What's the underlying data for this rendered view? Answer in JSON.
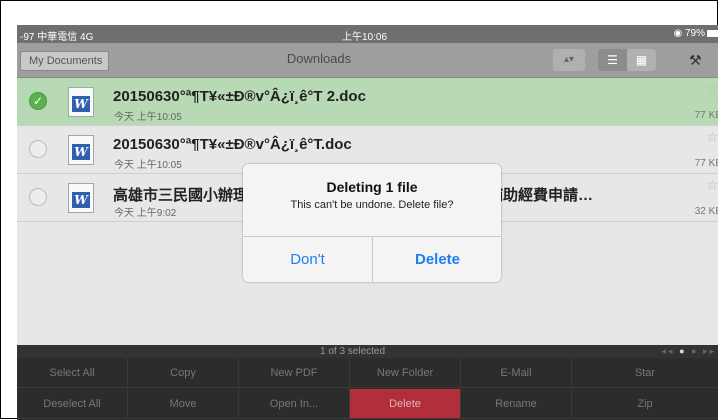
{
  "status_bar": {
    "carrier": "-97 中華電信  4G",
    "time": "上午10:06",
    "battery": "79%"
  },
  "nav": {
    "back_label": "My Documents",
    "title": "Downloads",
    "sort_icon": "sort-updown-icon",
    "list_view_icon": "list-view-icon",
    "grid_view_icon": "grid-view-icon",
    "tools_icon": "tools-icon"
  },
  "files": [
    {
      "name": "20150630°ª¶T¥«±Ð®v°Â¿ï¸ê°T 2.doc",
      "date": "今天 上午10:05",
      "size": "77 KB",
      "selected": true
    },
    {
      "name": "20150630°ª¶T¥«±Ð®v°Â¿ï¸ê°T.doc",
      "date": "今天 上午10:05",
      "size": "77 KB",
      "selected": false
    },
    {
      "name": "高雄市三民國小辦理「資訊科技融入教學應用培訓」研習補助經費申請…",
      "date": "今天 上午9:02",
      "size": "32 KB",
      "selected": false
    }
  ],
  "selection_status": "1 of 3 selected",
  "toolbar": {
    "row1": [
      "Select All",
      "Copy",
      "New PDF",
      "New Folder",
      "E-Mail",
      "Star"
    ],
    "row2": [
      "Deselect All",
      "Move",
      "Open In...",
      "Delete",
      "Rename",
      "Zip"
    ]
  },
  "dialog": {
    "title": "Deleting 1 file",
    "message": "This can't be undone. Delete file?",
    "cancel_label": "Don't",
    "confirm_label": "Delete"
  },
  "colors": {
    "selected_row": "#b7d9b3",
    "delete_button": "#b12e3b",
    "dialog_link": "#1c7ff2"
  }
}
